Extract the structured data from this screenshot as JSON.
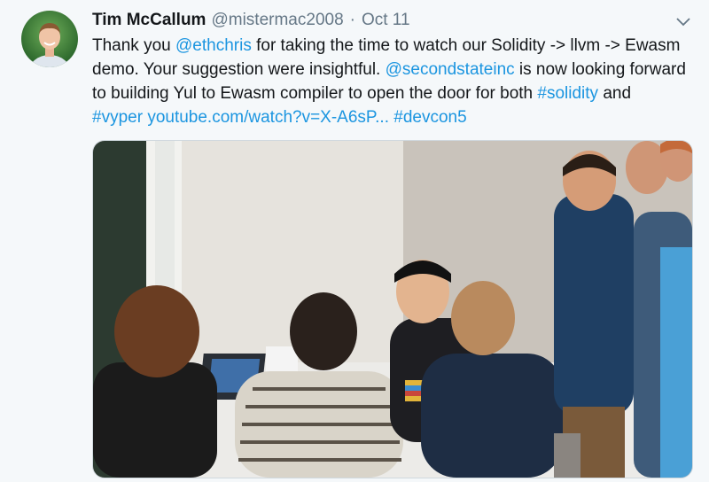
{
  "tweet": {
    "author_name": "Tim McCallum",
    "author_handle": "@mistermac2008",
    "separator": "·",
    "date": "Oct 11",
    "text_parts": {
      "t1": "Thank you ",
      "l1": "@ethchris",
      "t2": " for taking the time to watch our Solidity -> llvm -> Ewasm demo. Your suggestion were insightful. ",
      "l2": "@secondstateinc",
      "t3": " is now looking forward to building Yul to Ewasm compiler to open the door for both ",
      "l3": "#solidity",
      "t4": " and ",
      "l4": "#vyper",
      "t5": " ",
      "l5": "youtube.com/watch?v=X-A6sP...",
      "t6": " ",
      "l6": "#devcon5"
    }
  },
  "icons": {
    "menu": "chevron-down-icon"
  },
  "colors": {
    "link": "#1b95e0",
    "secondary_text": "#657786",
    "background": "#f5f8fa"
  }
}
